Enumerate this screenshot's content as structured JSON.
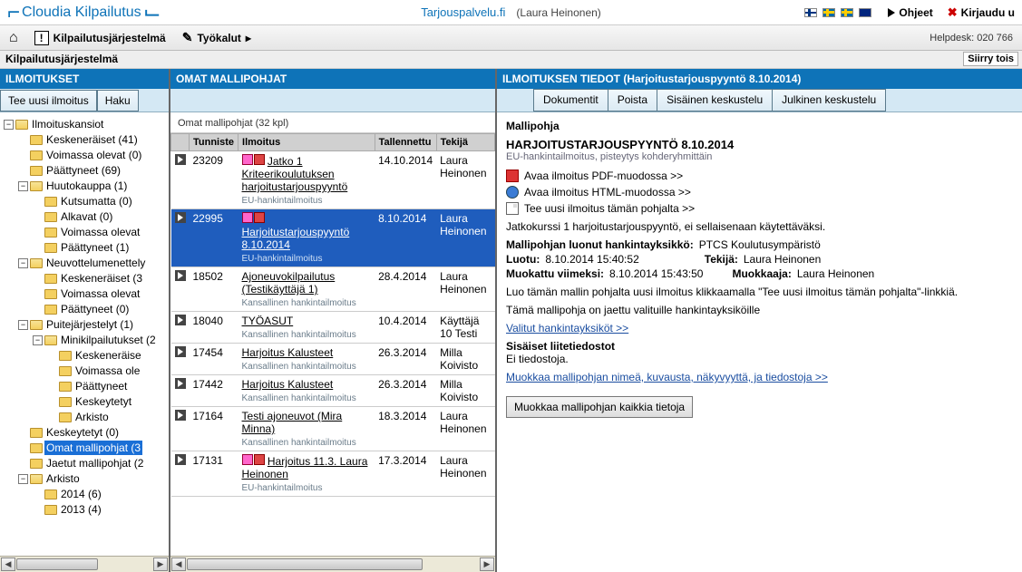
{
  "top": {
    "logo": "Cloudia Kilpailutus",
    "service": "Tarjouspalvelu.fi",
    "user": "(Laura Heinonen)",
    "ohjeet": "Ohjeet",
    "logout": "Kirjaudu u"
  },
  "toolbar": {
    "home": "",
    "kilpailutus": "Kilpailutusjärjestelmä",
    "tyokalut": "Työkalut",
    "helpdesk": "Helpdesk: 020 766"
  },
  "breadcrumb": "Kilpailutusjärjestelmä",
  "siirry": "Siirry tois",
  "pane1": {
    "header": "ILMOITUKSET",
    "btn_new": "Tee uusi ilmoitus",
    "btn_search": "Haku",
    "tree": {
      "root": "Ilmoituskansiot",
      "items": [
        {
          "label": "Keskeneräiset (41)"
        },
        {
          "label": "Voimassa olevat (0)"
        },
        {
          "label": "Päättyneet (69)"
        },
        {
          "label": "Huutokauppa (1)",
          "children": [
            {
              "label": "Kutsumatta (0)"
            },
            {
              "label": "Alkavat (0)"
            },
            {
              "label": "Voimassa olevat"
            },
            {
              "label": "Päättyneet (1)"
            }
          ]
        },
        {
          "label": "Neuvottelumenettely",
          "children": [
            {
              "label": "Keskeneräiset (3"
            },
            {
              "label": "Voimassa olevat"
            },
            {
              "label": "Päättyneet (0)"
            }
          ]
        },
        {
          "label": "Puitejärjestelyt (1)",
          "children": [
            {
              "label": "Minikilpailutukset (2",
              "children": [
                {
                  "label": "Keskeneräise"
                },
                {
                  "label": "Voimassa ole"
                },
                {
                  "label": "Päättyneet"
                },
                {
                  "label": "Keskeytetyt"
                },
                {
                  "label": "Arkisto"
                }
              ]
            }
          ]
        },
        {
          "label": "Keskeytetyt (0)"
        },
        {
          "label": "Omat mallipohjat (3",
          "selected": true
        },
        {
          "label": "Jaetut mallipohjat (2"
        },
        {
          "label": "Arkisto",
          "children": [
            {
              "label": "2014 (6)"
            },
            {
              "label": "2013 (4)"
            }
          ]
        }
      ]
    }
  },
  "pane2": {
    "header": "OMAT MALLIPOHJAT",
    "listhead": "Omat mallipohjat (32 kpl)",
    "cols": {
      "tunniste": "Tunniste",
      "ilmoitus": "Ilmoitus",
      "tallennettu": "Tallennettu",
      "tekija": "Tekijä"
    },
    "rows": [
      {
        "id": "23209",
        "title": "Jatko 1 Kriteerikoulutuksen harjoitustarjouspyyntö",
        "sub": "EU-hankintailmoitus",
        "date": "14.10.2014",
        "author": "Laura Heinonen",
        "icons": true
      },
      {
        "id": "22995",
        "title": "Harjoitustarjouspyyntö 8.10.2014",
        "sub": "EU-hankintailmoitus",
        "date": "8.10.2014",
        "author": "Laura Heinonen",
        "icons": true,
        "selected": true
      },
      {
        "id": "18502",
        "title": "Ajoneuvokilpailutus (Testikäyttäjä 1)",
        "sub": "Kansallinen hankintailmoitus",
        "date": "28.4.2014",
        "author": "Laura Heinonen"
      },
      {
        "id": "18040",
        "title": "TYÖASUT",
        "sub": "Kansallinen hankintailmoitus",
        "date": "10.4.2014",
        "author": "Käyttäjä 10 Testi"
      },
      {
        "id": "17454",
        "title": "Harjoitus Kalusteet",
        "sub": "Kansallinen hankintailmoitus",
        "date": "26.3.2014",
        "author": "Milla Koivisto"
      },
      {
        "id": "17442",
        "title": "Harjoitus Kalusteet",
        "sub": "Kansallinen hankintailmoitus",
        "date": "26.3.2014",
        "author": "Milla Koivisto"
      },
      {
        "id": "17164",
        "title": "Testi ajoneuvot (Mira Minna)",
        "sub": "Kansallinen hankintailmoitus",
        "date": "18.3.2014",
        "author": "Laura Heinonen"
      },
      {
        "id": "17131",
        "title": "Harjoitus 11.3. Laura Heinonen",
        "sub": "EU-hankintailmoitus",
        "date": "17.3.2014",
        "author": "Laura Heinonen",
        "icons": true
      }
    ]
  },
  "pane3": {
    "header": "ILMOITUKSEN TIEDOT (Harjoitustarjouspyyntö 8.10.2014)",
    "tabs": {
      "dokumentit": "Dokumentit",
      "poista": "Poista",
      "sisainen": "Sisäinen keskustelu",
      "julkinen": "Julkinen keskustelu"
    },
    "mallipohja_label": "Mallipohja",
    "title": "HARJOITUSTARJOUSPYYNTÖ 8.10.2014",
    "subtitle": "EU-hankintailmoitus, pisteytys kohderyhmittäin",
    "action_pdf": "Avaa ilmoitus PDF-muodossa >>",
    "action_html": "Avaa ilmoitus HTML-muodossa >>",
    "action_new": "Tee uusi ilmoitus tämän pohjalta >>",
    "desc1": "Jatkokurssi 1 harjoitustarjouspyyntö, ei sellaisenaan käytettäväksi.",
    "kv_unit_label": "Mallipohjan luonut hankintayksikkö:",
    "kv_unit_value": "PTCS Koulutusympäristö",
    "kv_created_label": "Luotu:",
    "kv_created_value": "8.10.2014 15:40:52",
    "kv_creator_label": "Tekijä:",
    "kv_creator_value": "Laura Heinonen",
    "kv_modified_label": "Muokattu viimeksi:",
    "kv_modified_value": "8.10.2014 15:43:50",
    "kv_modifier_label": "Muokkaaja:",
    "kv_modifier_value": "Laura Heinonen",
    "hint": "Luo tämän mallin pohjalta uusi ilmoitus klikkaamalla \"Tee uusi ilmoitus tämän pohjalta\"-linkkiä.",
    "shared": "Tämä mallipohja on jaettu valituille hankintayksiköille",
    "selected_units_link": "Valitut hankintayksiköt >>",
    "attach_head": "Sisäiset liitetiedostot",
    "attach_none": "Ei tiedostoja.",
    "edit_link": "Muokkaa mallipohjan nimeä, kuvausta, näkyvyyttä, ja tiedostoja >>",
    "edit_button": "Muokkaa mallipohjan kaikkia tietoja"
  }
}
